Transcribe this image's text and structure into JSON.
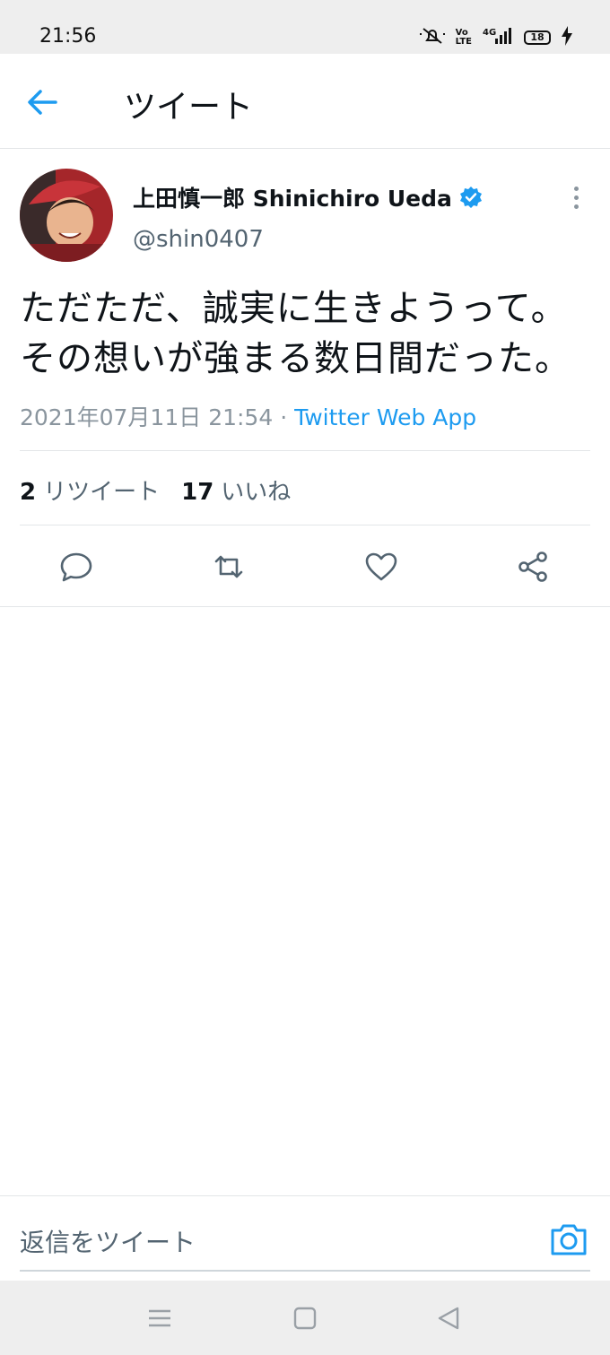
{
  "status_bar": {
    "time": "21:56",
    "battery": "18",
    "icons": [
      "mute-icon",
      "volte-icon",
      "4g-signal-icon",
      "battery-icon",
      "charging-icon"
    ]
  },
  "header": {
    "title": "ツイート",
    "back_icon": "arrow-left-icon"
  },
  "tweet": {
    "display_name": "上田慎一郎 Shinichiro Ueda",
    "verified": true,
    "handle": "@shin0407",
    "text_line1": "ただただ、誠実に生きようって。",
    "text_line2": "その想いが強まる数日間だった。",
    "timestamp": "2021年07月11日 21:54",
    "separator": " · ",
    "source": "Twitter Web App",
    "retweet_count": "2",
    "retweet_label": "リツイート",
    "like_count": "17",
    "like_label": "いいね"
  },
  "actions": [
    "reply-icon",
    "retweet-icon",
    "like-icon",
    "share-icon"
  ],
  "reply_bar": {
    "placeholder": "返信をツイート",
    "camera_icon": "camera-icon"
  },
  "nav_bar": {
    "icons": [
      "menu-icon",
      "home-square-icon",
      "back-triangle-icon"
    ]
  },
  "colors": {
    "accent": "#1d9bf0",
    "text": "#0f1419",
    "secondary": "#536471",
    "bars": "#eeeeee"
  }
}
